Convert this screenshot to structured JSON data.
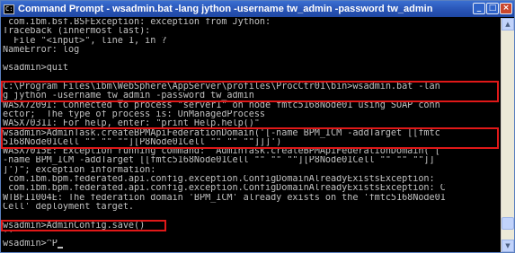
{
  "window": {
    "title": "Command Prompt - wsadmin.bat -lang jython -username tw_admin -password tw_admin",
    "app_icon": "cmd-icon",
    "buttons": {
      "minimize": "_",
      "maximize": "□",
      "close": "×"
    }
  },
  "console": {
    "lines": [
      " com.ibm.bsf.BSFException: exception from Jython:",
      "Traceback (innermost last):",
      "  File \"<input>\", line 1, in ?",
      "NameError: log",
      "",
      "wsadmin>quit",
      "",
      "C:\\Program Files\\ibm\\WebSphere\\AppServer\\profiles\\ProcCtr01\\bin>wsadmin.bat -lan",
      "g jython -username tw_admin -password tw_admin",
      "WASX7209I: Connected to process \"server1\" on node fmtc5168Node01 using SOAP conn",
      "ector;  The type of process is: UnManagedProcess",
      "WASX7031I: For help, enter: \"print Help.help()\"",
      "wsadmin>AdminTask.createBPMApiFederationDomain('[-name BPM_ICM -addTarget [[fmtc",
      "5168Node01Cell \"\" \"\" \"\"][P8Node01Cell \"\" \"\" \"\"]]]')",
      "WASX7015E: Exception running command: \"AdminTask.createBPMApiFederationDomain('[",
      "-name BPM_ICM -addTarget [[fmtc5168Node01Cell \"\" \"\" \"\"][P8Node01Cell \"\" \"\" \"\"]]",
      "]')\"; exception information:",
      " com.ibm.bpm.federated.api.config.exception.ConfigDomainAlreadyExistsException:",
      " com.ibm.bpm.federated.api.config.exception.ConfigDomainAlreadyExistsException: C",
      "WTBFI1004E: The federation domain 'BPM_ICM' already exists on the 'fmtc5168Node01",
      "Cell' deployment target.",
      "",
      "wsadmin>AdminConfig.save()",
      "''",
      "wsadmin>^P"
    ]
  },
  "scrollbar": {
    "up_icon": "scroll-up-arrow-icon",
    "down_icon": "scroll-down-arrow-icon",
    "scroll_position_fraction": 0.95
  },
  "colors": {
    "console_background": "#000000",
    "console_text": "#c0c0c0",
    "titlebar": "#2a56b8",
    "highlight_box": "#e01818"
  }
}
